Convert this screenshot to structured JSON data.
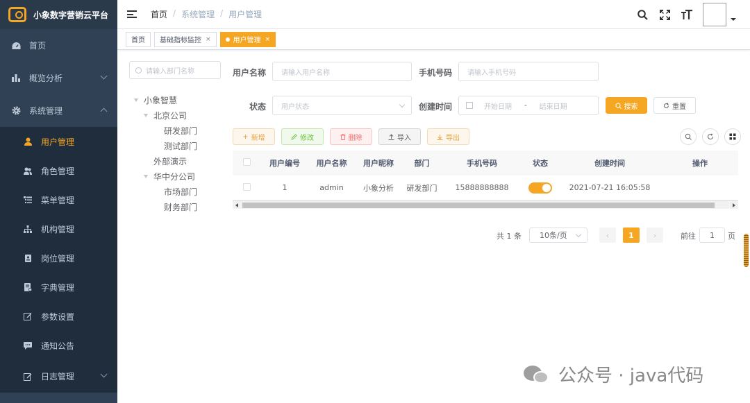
{
  "app": {
    "title": "小象数字营销云平台"
  },
  "sidebar": {
    "top_items": [
      {
        "label": "首页",
        "icon": "dashboard-icon"
      },
      {
        "label": "概览分析",
        "icon": "bar-chart-icon"
      },
      {
        "label": "系统管理",
        "icon": "gear-icon"
      }
    ],
    "sub_items": [
      {
        "label": "用户管理",
        "icon": "user-icon",
        "active": true
      },
      {
        "label": "角色管理",
        "icon": "peoples-icon"
      },
      {
        "label": "菜单管理",
        "icon": "tree-table-icon"
      },
      {
        "label": "机构管理",
        "icon": "tree-icon"
      },
      {
        "label": "岗位管理",
        "icon": "post-icon"
      },
      {
        "label": "字典管理",
        "icon": "dict-icon"
      },
      {
        "label": "参数设置",
        "icon": "edit-icon"
      },
      {
        "label": "通知公告",
        "icon": "message-icon"
      },
      {
        "label": "日志管理",
        "icon": "log-icon"
      }
    ],
    "accent_color": "#f5a623",
    "bg_color": "#304156"
  },
  "breadcrumb": {
    "items": [
      "首页",
      "系统管理",
      "用户管理"
    ],
    "separator": "/"
  },
  "tags": [
    {
      "label": "首页"
    },
    {
      "label": "基础指标监控",
      "close": "×"
    },
    {
      "label": "用户管理",
      "close": "×",
      "active": true
    }
  ],
  "dept": {
    "placeholder": "请输入部门名称",
    "tree": [
      {
        "label": "小象智慧",
        "level": 0,
        "expanded": true
      },
      {
        "label": "北京公司",
        "level": 1,
        "expanded": true
      },
      {
        "label": "研发部门",
        "level": 2
      },
      {
        "label": "测试部门",
        "level": 2
      },
      {
        "label": "外部演示",
        "level": 1
      },
      {
        "label": "华中分公司",
        "level": 1,
        "expanded": true
      },
      {
        "label": "市场部门",
        "level": 2
      },
      {
        "label": "财务部门",
        "level": 2
      }
    ]
  },
  "form": {
    "username_label": "用户名称",
    "username_placeholder": "请输入用户名称",
    "phone_label": "手机号码",
    "phone_placeholder": "请输入手机号码",
    "status_label": "状态",
    "status_placeholder": "用户状态",
    "created_label": "创建时间",
    "start_placeholder": "开始日期",
    "date_sep": "-",
    "end_placeholder": "结束日期",
    "search_label": "搜索",
    "reset_label": "重置"
  },
  "toolbar": {
    "add_label": "新增",
    "edit_label": "修改",
    "delete_label": "删除",
    "import_label": "导入",
    "export_label": "导出"
  },
  "table": {
    "columns": [
      "用户编号",
      "用户名称",
      "用户昵称",
      "部门",
      "手机号码",
      "状态",
      "创建时间",
      "操作"
    ],
    "rows": [
      {
        "id": "1",
        "username": "admin",
        "nickname": "小象分析",
        "dept": "研发部门",
        "phone": "15888888888",
        "status_on": true,
        "created": "2021-07-21 16:05:58"
      }
    ]
  },
  "pagination": {
    "total": "共 1 条",
    "page_size": "10条/页",
    "current": "1",
    "goto_label": "前往",
    "goto_value": "1",
    "page_unit": "页"
  },
  "watermark": {
    "text": "公众号 · java代码"
  }
}
